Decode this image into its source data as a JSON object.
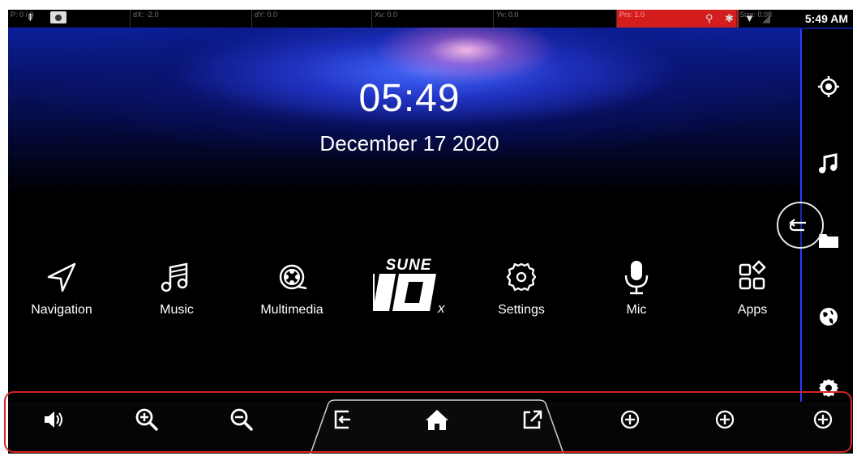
{
  "statusbar": {
    "fields": [
      "P: 0 / 0",
      "dX: -2.0",
      "dY: 0.0",
      "Xv: 0.0",
      "Yv: 0.0",
      "Prs: 1.0",
      "Size: 0.08"
    ],
    "time": "5:49 AM"
  },
  "home": {
    "clock": "05:49",
    "date": "December 17 2020"
  },
  "apps": [
    {
      "label": "Navigation",
      "icon": "navigation-arrow-icon"
    },
    {
      "label": "Music",
      "icon": "music-note-icon"
    },
    {
      "label": "Multimedia",
      "icon": "film-reel-icon"
    },
    {
      "label": "Settings",
      "icon": "gear-icon"
    },
    {
      "label": "Mic",
      "icon": "microphone-icon"
    },
    {
      "label": "Apps",
      "icon": "apps-grid-icon"
    }
  ],
  "brand": {
    "line1": "SUNE",
    "line2": "10",
    "suffix": "x"
  },
  "sidebar": [
    "gps-target-icon",
    "music-note-icon",
    "folder-icon",
    "globe-icon",
    "settings-gear-icon"
  ],
  "bottombar": [
    "volume-icon",
    "zoom-in-icon",
    "zoom-out-icon",
    "exit-icon",
    "home-icon",
    "external-link-icon",
    "add-circle-icon",
    "add-circle-icon",
    "add-circle-icon"
  ],
  "colors": {
    "accent_red": "#d52424",
    "sidebar_line": "#2b3cff",
    "wallpaper_blue": "#1e3cff"
  }
}
